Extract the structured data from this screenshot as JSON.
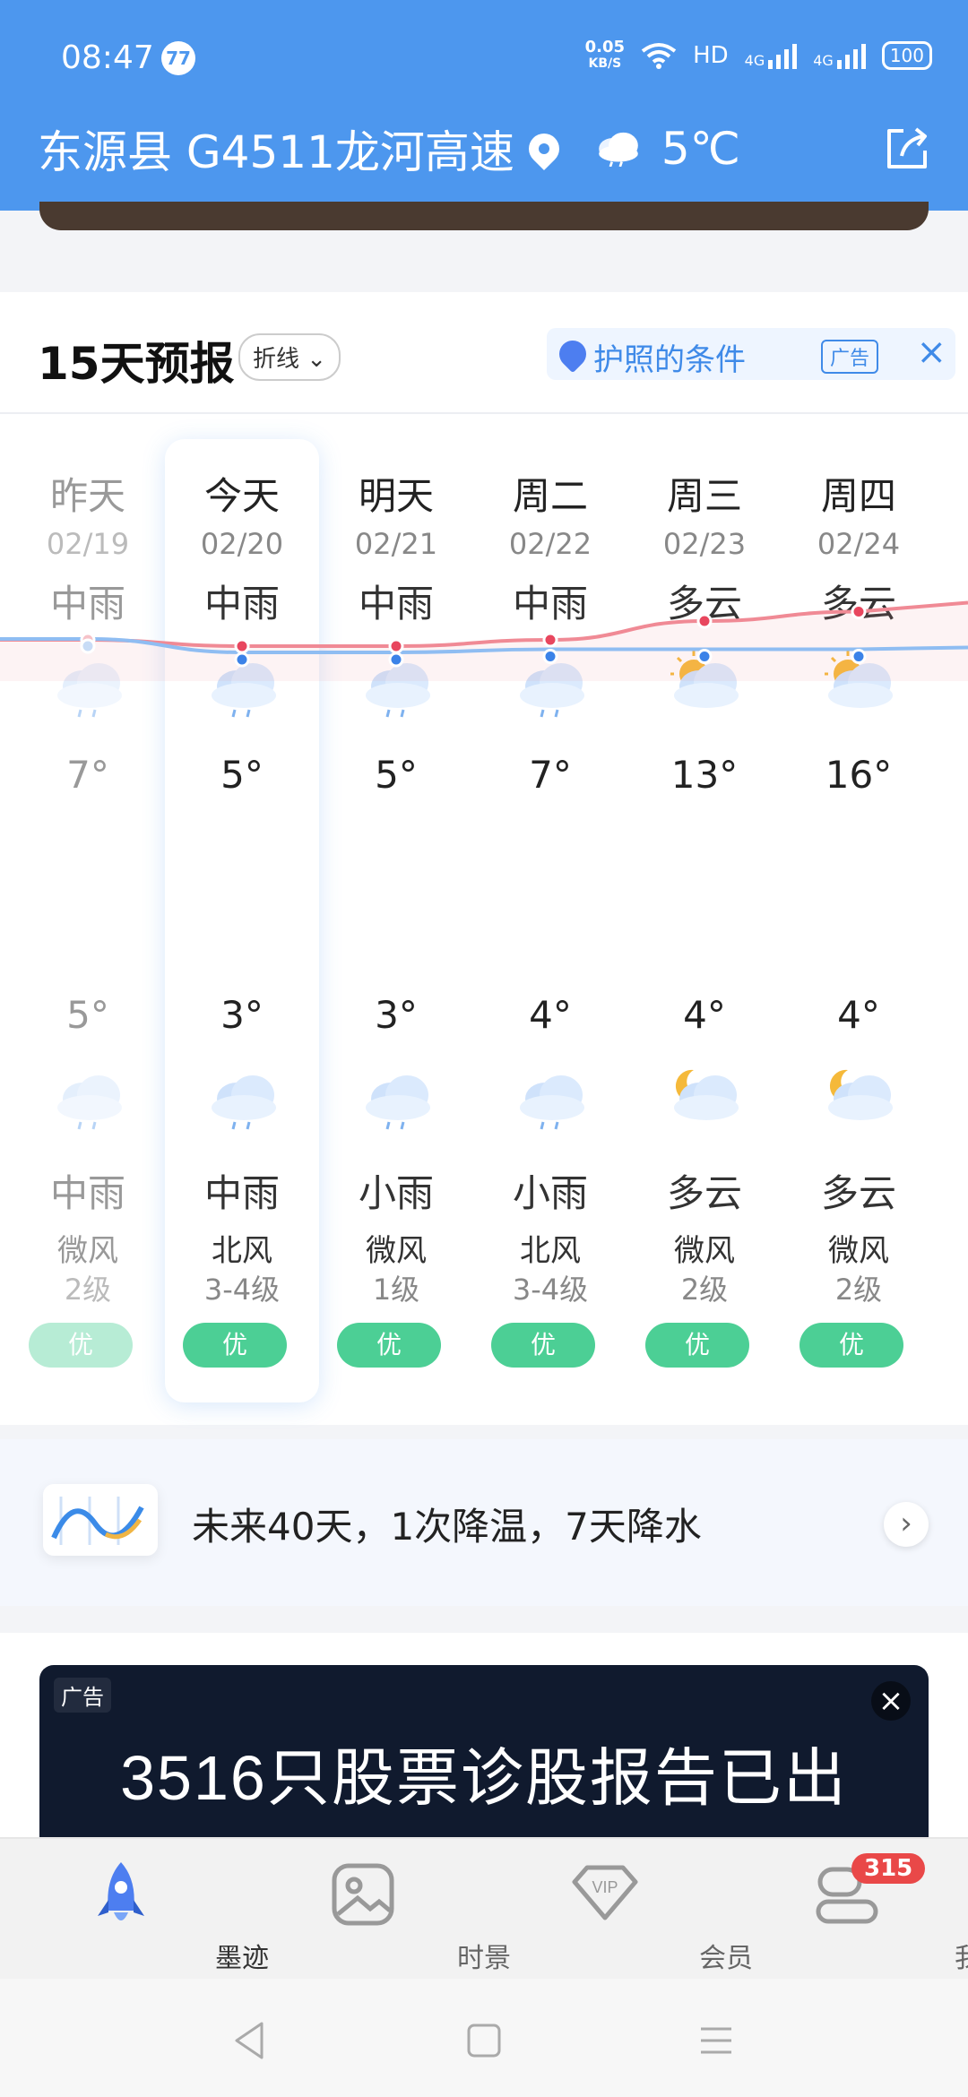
{
  "status_bar": {
    "time": "08:47",
    "badge": "77",
    "net_speed": "0.05",
    "net_unit": "KB/S",
    "hd": "HD",
    "sig1": "4G",
    "sig2": "4G",
    "battery": "100"
  },
  "header": {
    "location": "东源县 G4511龙河高速",
    "temperature": "5℃"
  },
  "forecast": {
    "title": "15天预报",
    "view_toggle": "折线",
    "ad_text": "护照的条件",
    "ad_tag": "广告",
    "days": [
      {
        "day": "昨天",
        "date": "02/19",
        "cond": "中雨",
        "hi": "7°",
        "lo": "5°",
        "night_cond": "中雨",
        "wind": "微风",
        "level": "2级",
        "aqi": "优",
        "day_icon": "rain-cloud-icon",
        "night_icon": "rain-cloud-icon"
      },
      {
        "day": "今天",
        "date": "02/20",
        "cond": "中雨",
        "hi": "5°",
        "lo": "3°",
        "night_cond": "中雨",
        "wind": "北风",
        "level": "3-4级",
        "aqi": "优",
        "day_icon": "rain-cloud-icon",
        "night_icon": "rain-cloud-icon"
      },
      {
        "day": "明天",
        "date": "02/21",
        "cond": "中雨",
        "hi": "5°",
        "lo": "3°",
        "night_cond": "小雨",
        "wind": "微风",
        "level": "1级",
        "aqi": "优",
        "day_icon": "rain-cloud-icon",
        "night_icon": "light-rain-cloud-icon"
      },
      {
        "day": "周二",
        "date": "02/22",
        "cond": "中雨",
        "hi": "7°",
        "lo": "4°",
        "night_cond": "小雨",
        "wind": "北风",
        "level": "3-4级",
        "aqi": "优",
        "day_icon": "rain-cloud-icon",
        "night_icon": "light-rain-cloud-icon"
      },
      {
        "day": "周三",
        "date": "02/23",
        "cond": "多云",
        "hi": "13°",
        "lo": "4°",
        "night_cond": "多云",
        "wind": "微风",
        "level": "2级",
        "aqi": "优",
        "day_icon": "sun-cloud-icon",
        "night_icon": "moon-cloud-icon"
      },
      {
        "day": "周四",
        "date": "02/24",
        "cond": "多云",
        "hi": "16°",
        "lo": "4°",
        "night_cond": "多云",
        "wind": "微风",
        "level": "2级",
        "aqi": "优",
        "day_icon": "sun-cloud-icon",
        "night_icon": "moon-cloud-icon"
      }
    ]
  },
  "forecast40": {
    "text": "未来40天，1次降温，7天降水"
  },
  "ad_banner": {
    "tag": "广告",
    "title": "3516只股票诊股报告已出"
  },
  "tabs": [
    {
      "label": "墨迹",
      "icon": "rocket-icon"
    },
    {
      "label": "时景",
      "icon": "photo-icon"
    },
    {
      "label": "会员",
      "icon": "vip-icon"
    },
    {
      "label": "我",
      "icon": "profile-icon",
      "count": "315"
    }
  ],
  "colors": {
    "header": "#4d97ee",
    "aqi_good": "#4ccf95",
    "high_line": "#f08a95",
    "low_line": "#8fbdf2"
  }
}
